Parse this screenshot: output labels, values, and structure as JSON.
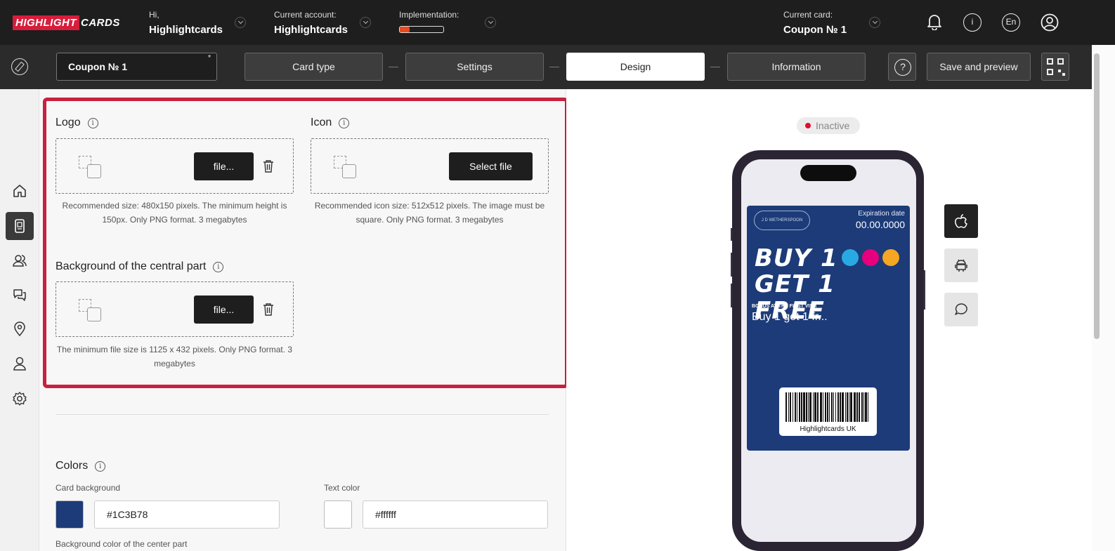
{
  "header": {
    "logo_text_a": "HIGHLIGHT",
    "logo_text_b": "CARDS",
    "greeting_small": "Hi,",
    "greeting_name": "Highlightcards",
    "account_small": "Current account:",
    "account_name": "Highlightcards",
    "implementation_label": "Implementation:",
    "implementation_progress": 0.22,
    "card_small": "Current card:",
    "card_name": "Coupon № 1",
    "lang": "En",
    "info_glyph": "i"
  },
  "subbar": {
    "card_name_value": "Coupon № 1",
    "required_mark": "*",
    "steps": [
      {
        "label": "Card type",
        "active": false
      },
      {
        "label": "Settings",
        "active": false
      },
      {
        "label": "Design",
        "active": true
      },
      {
        "label": "Information",
        "active": false
      }
    ],
    "help_glyph": "?",
    "save_label": "Save and preview"
  },
  "form": {
    "logo": {
      "title": "Logo",
      "button": "file...",
      "hint": "Recommended size: 480x150 pixels. The minimum height is 150px. Only PNG format. 3 megabytes"
    },
    "icon": {
      "title": "Icon",
      "button": "Select file",
      "hint": "Recommended icon size: 512x512 pixels. The image must be square. Only PNG format. 3 megabytes"
    },
    "background": {
      "title": "Background of the central part",
      "button": "file...",
      "hint": "The minimum file size is 1125 x 432 pixels. Only PNG format. 3 megabytes"
    },
    "colors": {
      "title": "Colors",
      "card_bg_label": "Card background",
      "card_bg_value": "#1C3B78",
      "text_color_label": "Text color",
      "text_color_value": "#ffffff",
      "center_bg_label": "Background color of the center part"
    },
    "info_glyph": "i"
  },
  "preview": {
    "status": "Inactive",
    "pass": {
      "logo_text": "J D WETHERSPOON",
      "expiration_label": "Expiration date",
      "expiration_value": "00.00.0000",
      "promo_line1": "BUY 1",
      "promo_line2": "GET 1  FREE",
      "bonus_label": "BONUS AT THE FIRST VISIT",
      "bonus_value": "Buy 1 get 1 fr...",
      "barcode_text": "Highlightcards UK"
    }
  },
  "colors": {
    "accent_red": "#c8203f",
    "brand_red": "#d71d3c",
    "card_bg": "#1c3b78",
    "topbar": "#1e1e1e",
    "progress_fill": "#e8491d"
  }
}
